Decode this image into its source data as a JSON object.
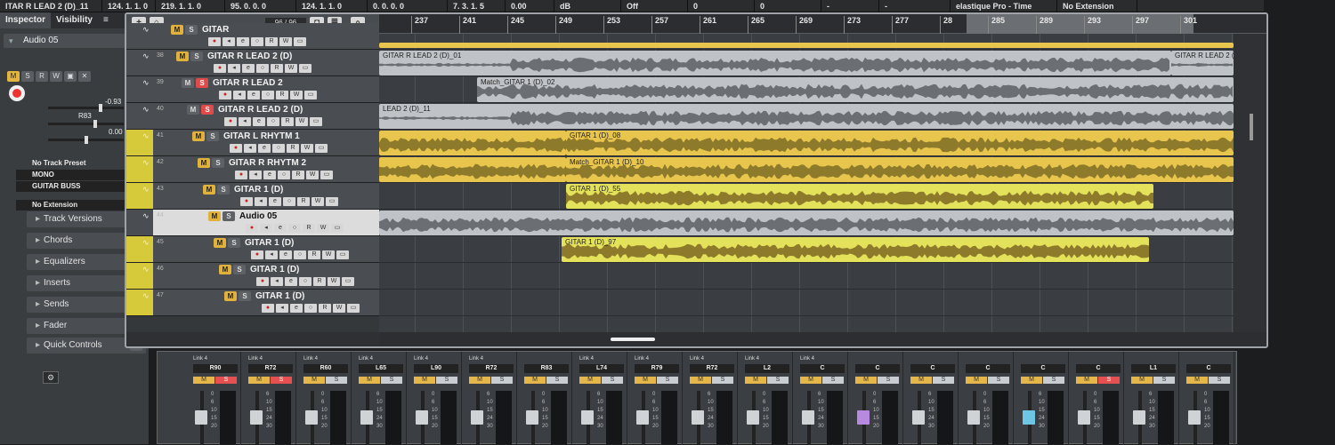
{
  "infoline": [
    "ITAR R LEAD 2 (D)_11",
    "124. 1. 1. 0",
    "219. 1. 1. 0",
    "95. 0. 0. 0",
    "124. 1. 1. 0",
    "0. 0. 0. 0",
    "7. 3. 1. 5",
    "0.00",
    "dB",
    "Off",
    "0",
    "0",
    "-",
    "-",
    "elastique Pro - Time",
    "No Extension"
  ],
  "inspector": {
    "tabs": [
      "Inspector",
      "Visibility",
      "≡"
    ],
    "track_name": "Audio 05",
    "volume_value": "-0.93",
    "pan_value": "R83",
    "delay_value": "0.00",
    "preset": "No Track Preset",
    "input": "MONO",
    "output": "GUITAR BUSS",
    "extension": "No Extension",
    "sections": [
      "Track Versions",
      "Chords",
      "Equalizers",
      "Inserts",
      "Sends",
      "Fader",
      "Quick Controls"
    ]
  },
  "toolbar": {
    "count": "96 / 96",
    "add": "+",
    "folder": "⌂"
  },
  "ruler": [
    "237",
    "241",
    "245",
    "249",
    "253",
    "257",
    "261",
    "265",
    "269",
    "273",
    "277",
    "28",
    "285",
    "289",
    "293",
    "297",
    "301"
  ],
  "tracks": [
    {
      "num": "",
      "name": "GITAR",
      "mute": true,
      "solo": false,
      "color": "none"
    },
    {
      "num": "38",
      "name": "GITAR R LEAD 2 (D)",
      "mute": true,
      "solo": false,
      "color": "none"
    },
    {
      "num": "39",
      "name": "GITAR R LEAD 2",
      "mute": false,
      "solo": true,
      "color": "none"
    },
    {
      "num": "40",
      "name": "GITAR R LEAD 2 (D)",
      "mute": false,
      "solo": true,
      "color": "none"
    },
    {
      "num": "41",
      "name": "GITAR L RHYTM 1",
      "mute": true,
      "solo": false,
      "color": "yellow"
    },
    {
      "num": "42",
      "name": "GITAR R RHYTM 2",
      "mute": true,
      "solo": false,
      "color": "yellow"
    },
    {
      "num": "43",
      "name": "GITAR 1 (D)",
      "mute": true,
      "solo": false,
      "color": "yellow"
    },
    {
      "num": "44",
      "name": "Audio 05",
      "mute": true,
      "solo": false,
      "color": "selected"
    },
    {
      "num": "45",
      "name": "GITAR 1 (D)",
      "mute": true,
      "solo": false,
      "color": "yellow"
    },
    {
      "num": "46",
      "name": "GITAR 1 (D)",
      "mute": true,
      "solo": false,
      "color": "yellow"
    },
    {
      "num": "47",
      "name": "GITAR 1 (D)",
      "mute": true,
      "solo": false,
      "color": "yellow"
    }
  ],
  "events": [
    [
      {
        "name": "",
        "type": "gold",
        "start": 0,
        "end": 960
      }
    ],
    [
      {
        "name": "GITAR R LEAD 2 (D)_01",
        "type": "gray",
        "start": 0,
        "end": 890
      },
      {
        "name": "GITAR R LEAD 2 (D)_02",
        "type": "gray",
        "start": 890,
        "end": 960
      }
    ],
    [
      {
        "name": "Match_GITAR 1 (D)_02",
        "type": "gray",
        "start": 110,
        "end": 960
      }
    ],
    [
      {
        "name": "LEAD 2 (D)_11",
        "type": "gray",
        "start": 0,
        "end": 960
      }
    ],
    [
      {
        "name": "",
        "type": "gold",
        "start": 0,
        "end": 210
      },
      {
        "name": "GITAR 1 (D)_08",
        "type": "gold",
        "start": 210,
        "end": 960
      }
    ],
    [
      {
        "name": "",
        "type": "gold",
        "start": 0,
        "end": 210
      },
      {
        "name": "Match_GITAR 1 (D)_10",
        "type": "gold",
        "start": 210,
        "end": 960
      }
    ],
    [
      {
        "name": "GITAR 1 (D)_55",
        "type": "lime",
        "start": 210,
        "end": 870
      }
    ],
    [
      {
        "name": "",
        "type": "gray",
        "start": 0,
        "end": 960
      }
    ],
    [
      {
        "name": "GITAR 1 (D)_97",
        "type": "lime",
        "start": 205,
        "end": 865
      }
    ],
    [],
    []
  ],
  "mixer": [
    {
      "link": "Link 4",
      "pan": "R90",
      "solo": true,
      "cap": "normal"
    },
    {
      "link": "Link 4",
      "pan": "R72",
      "solo": true,
      "cap": "normal"
    },
    {
      "link": "Link 4",
      "pan": "R60",
      "solo": false,
      "cap": "normal"
    },
    {
      "link": "Link 4",
      "pan": "L65",
      "solo": false,
      "cap": "normal"
    },
    {
      "link": "Link 4",
      "pan": "L90",
      "solo": false,
      "cap": "normal"
    },
    {
      "link": "Link 4",
      "pan": "R72",
      "solo": false,
      "cap": "normal"
    },
    {
      "link": "",
      "pan": "R83",
      "solo": false,
      "cap": "normal"
    },
    {
      "link": "Link 4",
      "pan": "L74",
      "solo": false,
      "cap": "normal"
    },
    {
      "link": "Link 4",
      "pan": "R79",
      "solo": false,
      "cap": "normal"
    },
    {
      "link": "Link 4",
      "pan": "R72",
      "solo": false,
      "cap": "normal"
    },
    {
      "link": "Link 4",
      "pan": "L2",
      "solo": false,
      "cap": "normal"
    },
    {
      "link": "Link 4",
      "pan": "C",
      "solo": false,
      "cap": "normal"
    },
    {
      "link": "",
      "pan": "C",
      "solo": false,
      "cap": "purple"
    },
    {
      "link": "",
      "pan": "C",
      "solo": false,
      "cap": "normal"
    },
    {
      "link": "",
      "pan": "C",
      "solo": false,
      "cap": "normal"
    },
    {
      "link": "",
      "pan": "C",
      "solo": false,
      "cap": "cyan"
    },
    {
      "link": "",
      "pan": "C",
      "solo": true,
      "cap": "normal"
    },
    {
      "link": "",
      "pan": "L1",
      "solo": false,
      "cap": "normal"
    },
    {
      "link": "",
      "pan": "C",
      "solo": false,
      "cap": "normal"
    }
  ],
  "mixer_scale": [
    "0",
    "6",
    "10",
    "15",
    "20"
  ],
  "mixer_scale_alt": [
    "6",
    "10",
    "15",
    "24",
    "30"
  ]
}
